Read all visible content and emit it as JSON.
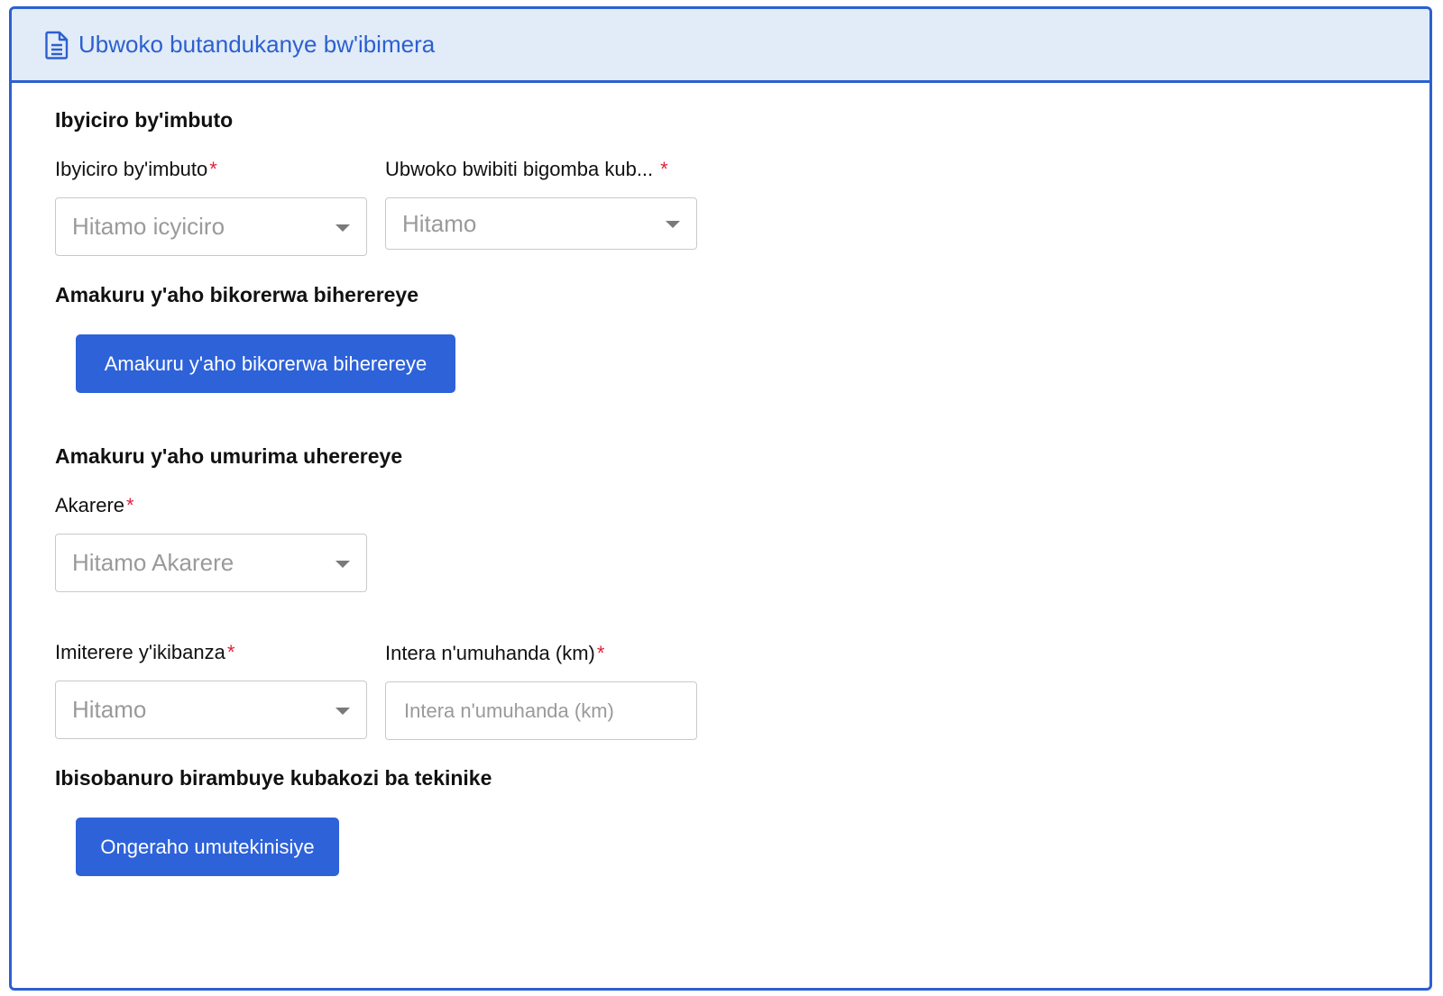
{
  "header": {
    "title": "Ubwoko butandukanye bw'ibimera",
    "icon": "document-icon"
  },
  "sections": {
    "seed_stage": {
      "title": "Ibyiciro by'imbuto",
      "stage_field": {
        "label": "Ibyiciro by'imbuto",
        "required_mark": "*",
        "placeholder": "Hitamo icyiciro"
      },
      "type_field": {
        "label": "Ubwoko bwibiti bigomba kub...",
        "required_mark": "*",
        "placeholder": "Hitamo"
      }
    },
    "production_location": {
      "title": "Amakuru y'aho bikorerwa biherereye",
      "button_label": "Amakuru y'aho bikorerwa biherereye"
    },
    "farmer_location": {
      "title": "Amakuru y'aho umurima uherereye",
      "district_field": {
        "label": "Akarere",
        "required_mark": "*",
        "placeholder": "Hitamo Akarere"
      },
      "land_field": {
        "label": "Imiterere y'ikibanza",
        "required_mark": "*",
        "placeholder": "Hitamo"
      },
      "distance_field": {
        "label": "Intera n'umuhanda (km)",
        "required_mark": "*",
        "placeholder": "Intera n'umuhanda (km)"
      }
    },
    "technicians": {
      "title": "Ibisobanuro birambuye kubakozi ba tekinike",
      "button_label": "Ongeraho umutekinisiye"
    }
  },
  "colors": {
    "accent": "#2d5fcf",
    "header_bg": "#e1ecf8",
    "button_bg": "#2e62d9",
    "required": "#e0213a",
    "placeholder": "#9a9a9a"
  }
}
